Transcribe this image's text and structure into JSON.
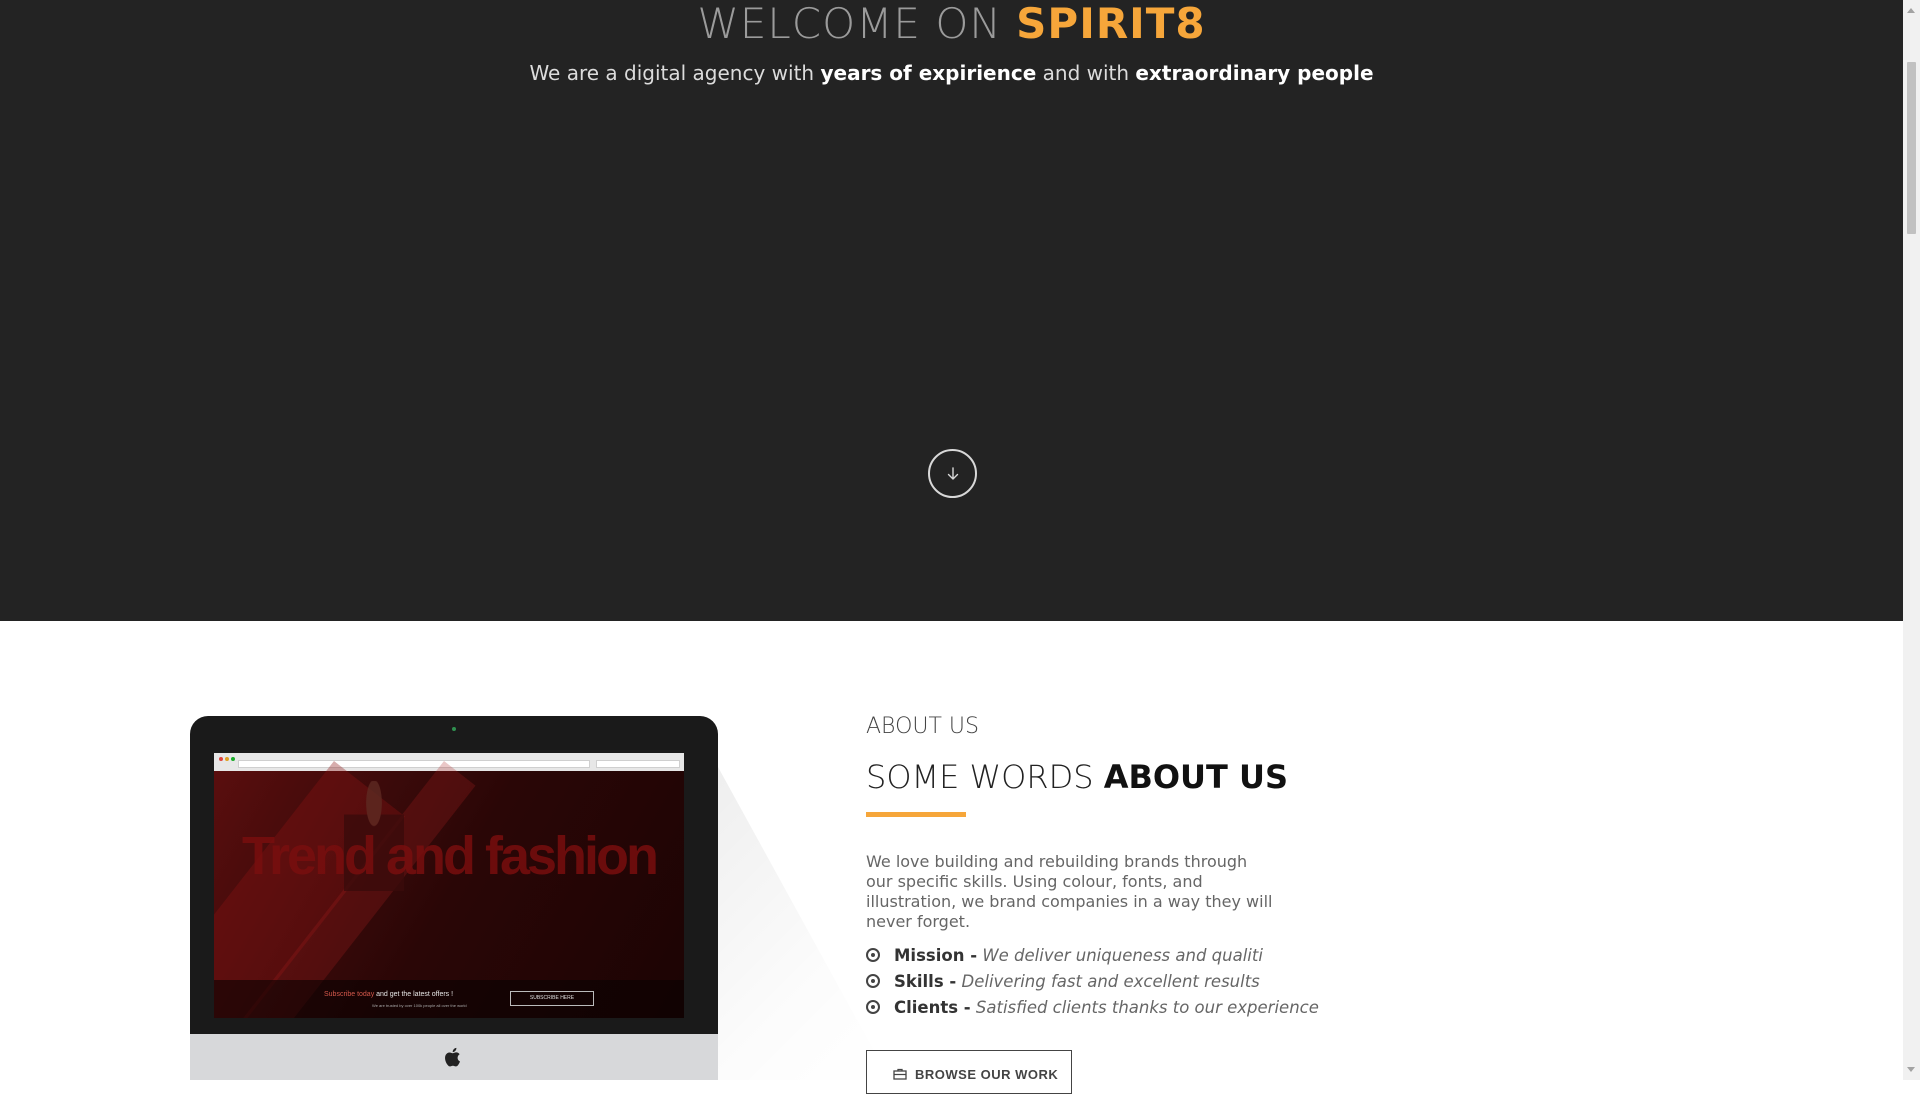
{
  "hero": {
    "title_prefix": "WELCOME ON ",
    "title_brand": "SPIRIT8",
    "subtitle_1": "We are a digital agency with ",
    "subtitle_2": "years of expirience",
    "subtitle_3": " and with ",
    "subtitle_4": "extraordinary people",
    "scroll_icon": "arrow-down-circle-icon"
  },
  "mockup": {
    "headline": "Trend and fashion",
    "subscribe_prefix": "Subscribe today",
    "subscribe_rest": " and get the latest offers !",
    "small_text": "We are trusted by over 100k people all over the world",
    "button": "SUBSCRIBE HERE",
    "logo_icon": "apple-logo-icon"
  },
  "about": {
    "eyebrow": "ABOUT US",
    "title_light": "SOME WORDS ",
    "title_bold": "ABOUT US",
    "body": "We love building and rebuilding brands through our specific skills. Using colour, fonts, and illustration, we brand companies in a way they will never forget.",
    "items": [
      {
        "term": "Mission -",
        "desc": "We deliver uniqueness and qualiti"
      },
      {
        "term": "Skills -",
        "desc": "Delivering fast and excellent results"
      },
      {
        "term": "Clients -",
        "desc": "Satisfied clients thanks to our experience"
      }
    ],
    "button_label": "BROWSE OUR WORK"
  },
  "colors": {
    "hero_bg": "#232323",
    "accent": "#f6a63a"
  }
}
